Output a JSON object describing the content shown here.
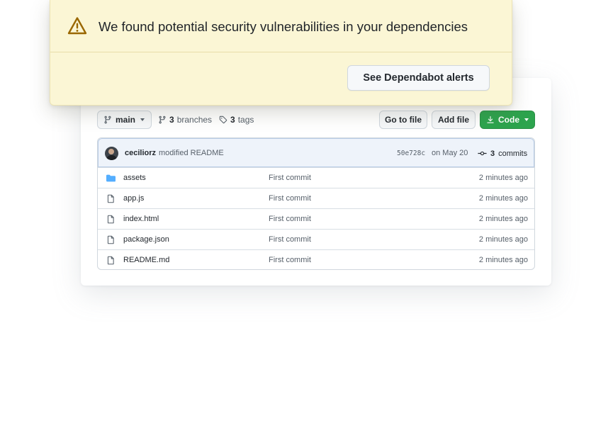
{
  "alert": {
    "message": "We found potential security vulnerabilities in your dependencies",
    "button_label": "See Dependabot alerts",
    "icon": "alert-icon"
  },
  "toolbar": {
    "branch": "main",
    "branches_count": "3",
    "branches_label": "branches",
    "tags_count": "3",
    "tags_label": "tags",
    "goto_label": "Go to file",
    "addfile_label": "Add file",
    "code_label": "Code"
  },
  "commit": {
    "author": "ceciliorz",
    "message": "modified README",
    "sha": "50e728c",
    "date": "on May 20",
    "count": "3",
    "count_label": "commits"
  },
  "files": [
    {
      "name": "assets",
      "type": "folder",
      "commit": "First commit",
      "age": "2 minutes ago"
    },
    {
      "name": "app.js",
      "type": "file",
      "commit": "First commit",
      "age": "2 minutes ago"
    },
    {
      "name": "index.html",
      "type": "file",
      "commit": "First commit",
      "age": "2 minutes ago"
    },
    {
      "name": "package.json",
      "type": "file",
      "commit": "First commit",
      "age": "2 minutes ago"
    },
    {
      "name": "README.md",
      "type": "file",
      "commit": "First commit",
      "age": "2 minutes ago"
    }
  ],
  "colors": {
    "alert_bg": "#fbf6d5",
    "alert_icon": "#9a6700",
    "code_button": "#2da44e",
    "folder_icon": "#54aeff"
  }
}
